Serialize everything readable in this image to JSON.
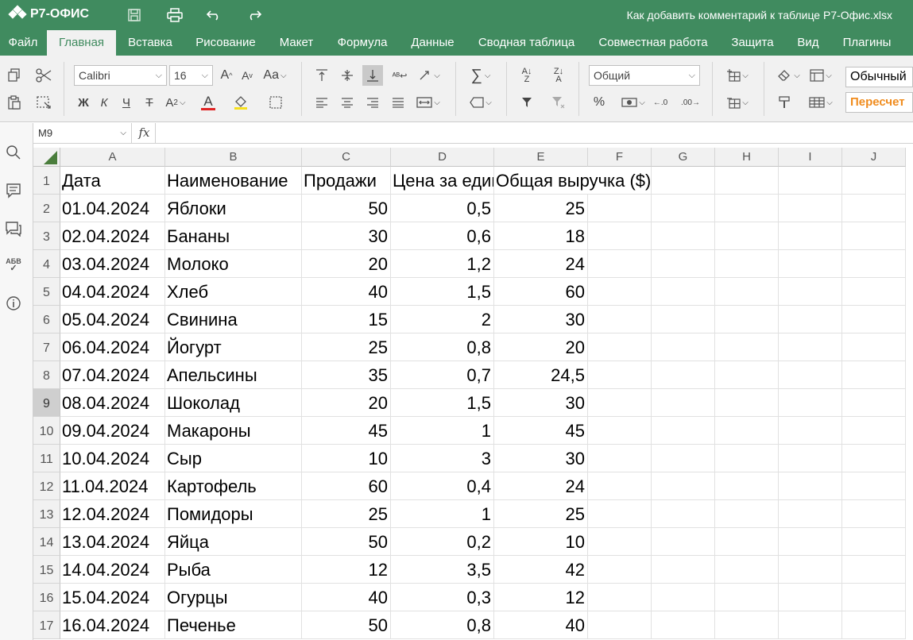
{
  "app": {
    "name": "Р7-ОФИС",
    "doc_title": "Как добавить комментарий к таблице Р7-Офис.xlsx"
  },
  "tabs": [
    "Файл",
    "Главная",
    "Вставка",
    "Рисование",
    "Макет",
    "Формула",
    "Данные",
    "Сводная таблица",
    "Совместная работа",
    "Защита",
    "Вид",
    "Плагины"
  ],
  "active_tab": "Главная",
  "toolbar": {
    "font_name": "Calibri",
    "font_size": "16",
    "number_format": "Общий",
    "bold": "Ж",
    "italic": "К",
    "underline": "Ч",
    "style_normal": "Обычный",
    "style_recalc": "Пересчет"
  },
  "formula_bar": {
    "name_box": "M9",
    "fx": "fx",
    "content": ""
  },
  "columns": [
    "A",
    "B",
    "C",
    "D",
    "E",
    "F",
    "G",
    "H",
    "I",
    "J"
  ],
  "selected_row": 9,
  "rows": [
    {
      "n": "1",
      "a": "Дата",
      "b": "Наименование",
      "c": "Продажи",
      "d": "Цена за единицу",
      "e": "Общая выручка ($)"
    },
    {
      "n": "2",
      "a": "01.04.2024",
      "b": "Яблоки",
      "c": "50",
      "d": "0,5",
      "e": "25"
    },
    {
      "n": "3",
      "a": "02.04.2024",
      "b": "Бананы",
      "c": "30",
      "d": "0,6",
      "e": "18"
    },
    {
      "n": "4",
      "a": "03.04.2024",
      "b": "Молоко",
      "c": "20",
      "d": "1,2",
      "e": "24"
    },
    {
      "n": "5",
      "a": "04.04.2024",
      "b": "Хлеб",
      "c": "40",
      "d": "1,5",
      "e": "60"
    },
    {
      "n": "6",
      "a": "05.04.2024",
      "b": "Свинина",
      "c": "15",
      "d": "2",
      "e": "30"
    },
    {
      "n": "7",
      "a": "06.04.2024",
      "b": "Йогурт",
      "c": "25",
      "d": "0,8",
      "e": "20"
    },
    {
      "n": "8",
      "a": "07.04.2024",
      "b": "Апельсины",
      "c": "35",
      "d": "0,7",
      "e": "24,5"
    },
    {
      "n": "9",
      "a": "08.04.2024",
      "b": "Шоколад",
      "c": "20",
      "d": "1,5",
      "e": "30"
    },
    {
      "n": "10",
      "a": "09.04.2024",
      "b": "Макароны",
      "c": "45",
      "d": "1",
      "e": "45"
    },
    {
      "n": "11",
      "a": "10.04.2024",
      "b": "Сыр",
      "c": "10",
      "d": "3",
      "e": "30"
    },
    {
      "n": "12",
      "a": "11.04.2024",
      "b": "Картофель",
      "c": "60",
      "d": "0,4",
      "e": "24"
    },
    {
      "n": "13",
      "a": "12.04.2024",
      "b": "Помидоры",
      "c": "25",
      "d": "1",
      "e": "25"
    },
    {
      "n": "14",
      "a": "13.04.2024",
      "b": "Яйца",
      "c": "50",
      "d": "0,2",
      "e": "10"
    },
    {
      "n": "15",
      "a": "14.04.2024",
      "b": "Рыба",
      "c": "12",
      "d": "3,5",
      "e": "42"
    },
    {
      "n": "16",
      "a": "15.04.2024",
      "b": "Огурцы",
      "c": "40",
      "d": "0,3",
      "e": "12"
    },
    {
      "n": "17",
      "a": "16.04.2024",
      "b": "Печенье",
      "c": "50",
      "d": "0,8",
      "e": "40"
    }
  ],
  "colors": {
    "brand": "#408b5f",
    "recalc": "#f08c1e",
    "font_color_underline": "#e02424",
    "highlight_underline": "#f7e01c"
  }
}
